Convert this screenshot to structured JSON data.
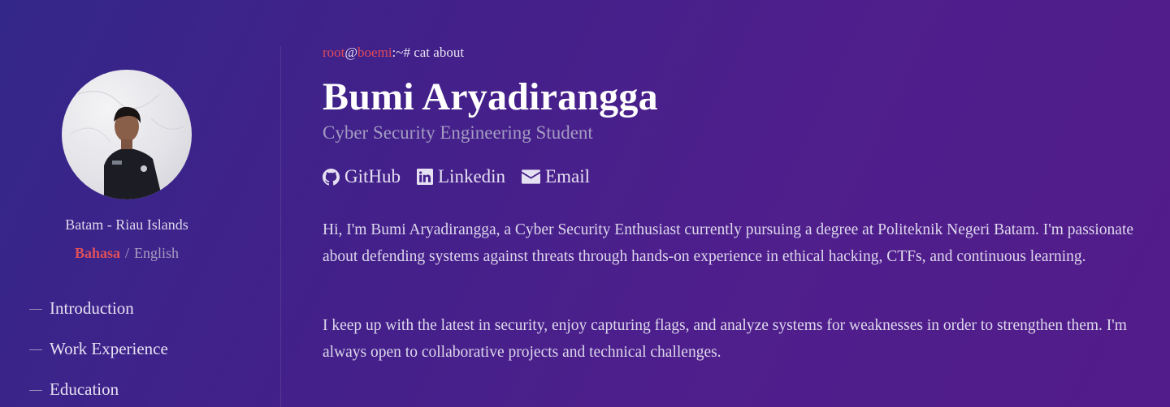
{
  "profile": {
    "location": "Batam - Riau Islands",
    "languages": [
      "Bahasa",
      "English"
    ],
    "active_language": "Bahasa",
    "separator": "/"
  },
  "nav": {
    "items": [
      "Introduction",
      "Work Experience",
      "Education"
    ]
  },
  "header": {
    "prompt_user": "root",
    "prompt_at": "@",
    "prompt_host": "boemi",
    "prompt_rest": ":~# cat about",
    "name": "Bumi Aryadirangga",
    "role": "Cyber Security Engineering Student"
  },
  "links": [
    {
      "label": "GitHub",
      "icon": "github-icon"
    },
    {
      "label": "Linkedin",
      "icon": "linkedin-icon"
    },
    {
      "label": "Email",
      "icon": "mail-icon"
    }
  ],
  "about": {
    "p1": "Hi, I'm Bumi Aryadirangga, a Cyber Security Enthusiast currently pursuing a degree at Politeknik Negeri Batam. I'm passionate about defending systems against threats through hands-on experience in ethical hacking, CTFs, and continuous learning.",
    "p2": "I keep up with the latest in security, enjoy capturing flags, and analyze systems for weaknesses in order to strengthen them. I'm always open to collaborative projects and technical challenges."
  },
  "colors": {
    "accent_red": "#e24a5a",
    "background_start": "#34278a",
    "background_end": "#521c8a"
  }
}
